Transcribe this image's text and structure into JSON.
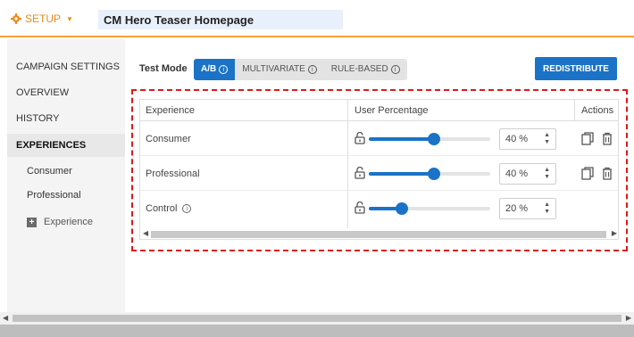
{
  "header": {
    "setup_label": "SETUP",
    "title": "CM Hero Teaser Homepage"
  },
  "sidebar": {
    "items": [
      {
        "label": "CAMPAIGN SETTINGS"
      },
      {
        "label": "OVERVIEW"
      },
      {
        "label": "HISTORY"
      },
      {
        "label": "EXPERIENCES"
      },
      {
        "label": "Consumer"
      },
      {
        "label": "Professional"
      },
      {
        "label": "Experience"
      }
    ]
  },
  "test_mode": {
    "label": "Test Mode",
    "options": [
      {
        "label": "A/B",
        "selected": true
      },
      {
        "label": "MULTIVARIATE",
        "selected": false
      },
      {
        "label": "RULE-BASED",
        "selected": false
      }
    ]
  },
  "redistribute_label": "REDISTRIBUTE",
  "table": {
    "headers": [
      "Experience",
      "User Percentage",
      "Actions"
    ],
    "rows": [
      {
        "name": "Consumer",
        "percent": 40,
        "percent_text": "40 %",
        "has_info": false,
        "actions": [
          "copy-icon",
          "trash-icon"
        ]
      },
      {
        "name": "Professional",
        "percent": 40,
        "percent_text": "40 %",
        "has_info": false,
        "actions": [
          "copy-icon",
          "trash-icon"
        ]
      },
      {
        "name": "Control",
        "percent": 20,
        "percent_text": "20 %",
        "has_info": true,
        "actions": []
      }
    ]
  },
  "colors": {
    "accent": "#1a73c6",
    "setup_orange": "#e88c1b",
    "highlight_dashed": "#e01818"
  },
  "info_glyph": "i"
}
